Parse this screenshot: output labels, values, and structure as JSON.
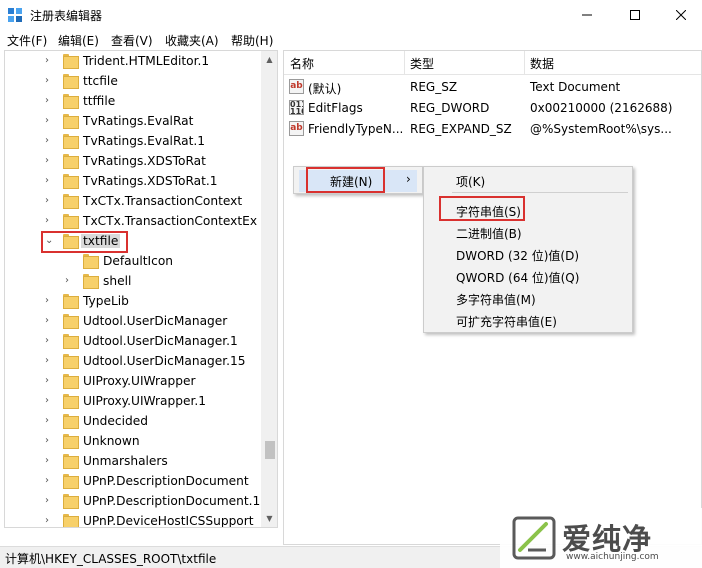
{
  "window": {
    "title": "注册表编辑器"
  },
  "menubar": {
    "items": [
      "文件(F)",
      "编辑(E)",
      "查看(V)",
      "收藏夹(A)",
      "帮助(H)"
    ]
  },
  "tree": {
    "items": [
      {
        "label": "Trident.HTMLEditor.1",
        "level": 0,
        "expandable": true
      },
      {
        "label": "ttcfile",
        "level": 0,
        "expandable": true
      },
      {
        "label": "ttffile",
        "level": 0,
        "expandable": true
      },
      {
        "label": "TvRatings.EvalRat",
        "level": 0,
        "expandable": true
      },
      {
        "label": "TvRatings.EvalRat.1",
        "level": 0,
        "expandable": true
      },
      {
        "label": "TvRatings.XDSToRat",
        "level": 0,
        "expandable": true
      },
      {
        "label": "TvRatings.XDSToRat.1",
        "level": 0,
        "expandable": true
      },
      {
        "label": "TxCTx.TransactionContext",
        "level": 0,
        "expandable": true
      },
      {
        "label": "TxCTx.TransactionContextEx",
        "level": 0,
        "expandable": true
      },
      {
        "label": "txtfile",
        "level": 0,
        "expandable": true,
        "expanded": true,
        "selected": true
      },
      {
        "label": "DefaultIcon",
        "level": 1,
        "expandable": false
      },
      {
        "label": "shell",
        "level": 1,
        "expandable": true
      },
      {
        "label": "TypeLib",
        "level": 0,
        "expandable": true
      },
      {
        "label": "Udtool.UserDicManager",
        "level": 0,
        "expandable": true
      },
      {
        "label": "Udtool.UserDicManager.1",
        "level": 0,
        "expandable": true
      },
      {
        "label": "Udtool.UserDicManager.15",
        "level": 0,
        "expandable": true
      },
      {
        "label": "UIProxy.UIWrapper",
        "level": 0,
        "expandable": true
      },
      {
        "label": "UIProxy.UIWrapper.1",
        "level": 0,
        "expandable": true
      },
      {
        "label": "Undecided",
        "level": 0,
        "expandable": true
      },
      {
        "label": "Unknown",
        "level": 0,
        "expandable": true
      },
      {
        "label": "Unmarshalers",
        "level": 0,
        "expandable": true
      },
      {
        "label": "UPnP.DescriptionDocument",
        "level": 0,
        "expandable": true
      },
      {
        "label": "UPnP.DescriptionDocument.1",
        "level": 0,
        "expandable": true
      },
      {
        "label": "UPnP.DeviceHostICSSupport",
        "level": 0,
        "expandable": true
      }
    ]
  },
  "list": {
    "columns": [
      "名称",
      "类型",
      "数据"
    ],
    "rows": [
      {
        "icon": "string-value-icon",
        "name": "(默认)",
        "type": "REG_SZ",
        "data": "Text Document"
      },
      {
        "icon": "binary-value-icon",
        "name": "EditFlags",
        "type": "REG_DWORD",
        "data": "0x00210000 (2162688)"
      },
      {
        "icon": "string-value-icon",
        "name": "FriendlyTypeN...",
        "type": "REG_EXPAND_SZ",
        "data": "@%SystemRoot%\\sys..."
      }
    ]
  },
  "context_menu": {
    "item": "新建(N)",
    "submenu": {
      "key": "项(K)",
      "items": [
        "字符串值(S)",
        "二进制值(B)",
        "DWORD (32 位)值(D)",
        "QWORD (64 位)值(Q)",
        "多字符串值(M)",
        "可扩充字符串值(E)"
      ]
    }
  },
  "statusbar": {
    "path": "计算机\\HKEY_CLASSES_ROOT\\txtfile"
  },
  "watermark": {
    "text": "爱纯净",
    "url": "www.aichunjing.com"
  },
  "colors": {
    "annotation": "#d9312f",
    "menu_highlight": "#d9e6f7",
    "folder": "#f7d06a"
  }
}
